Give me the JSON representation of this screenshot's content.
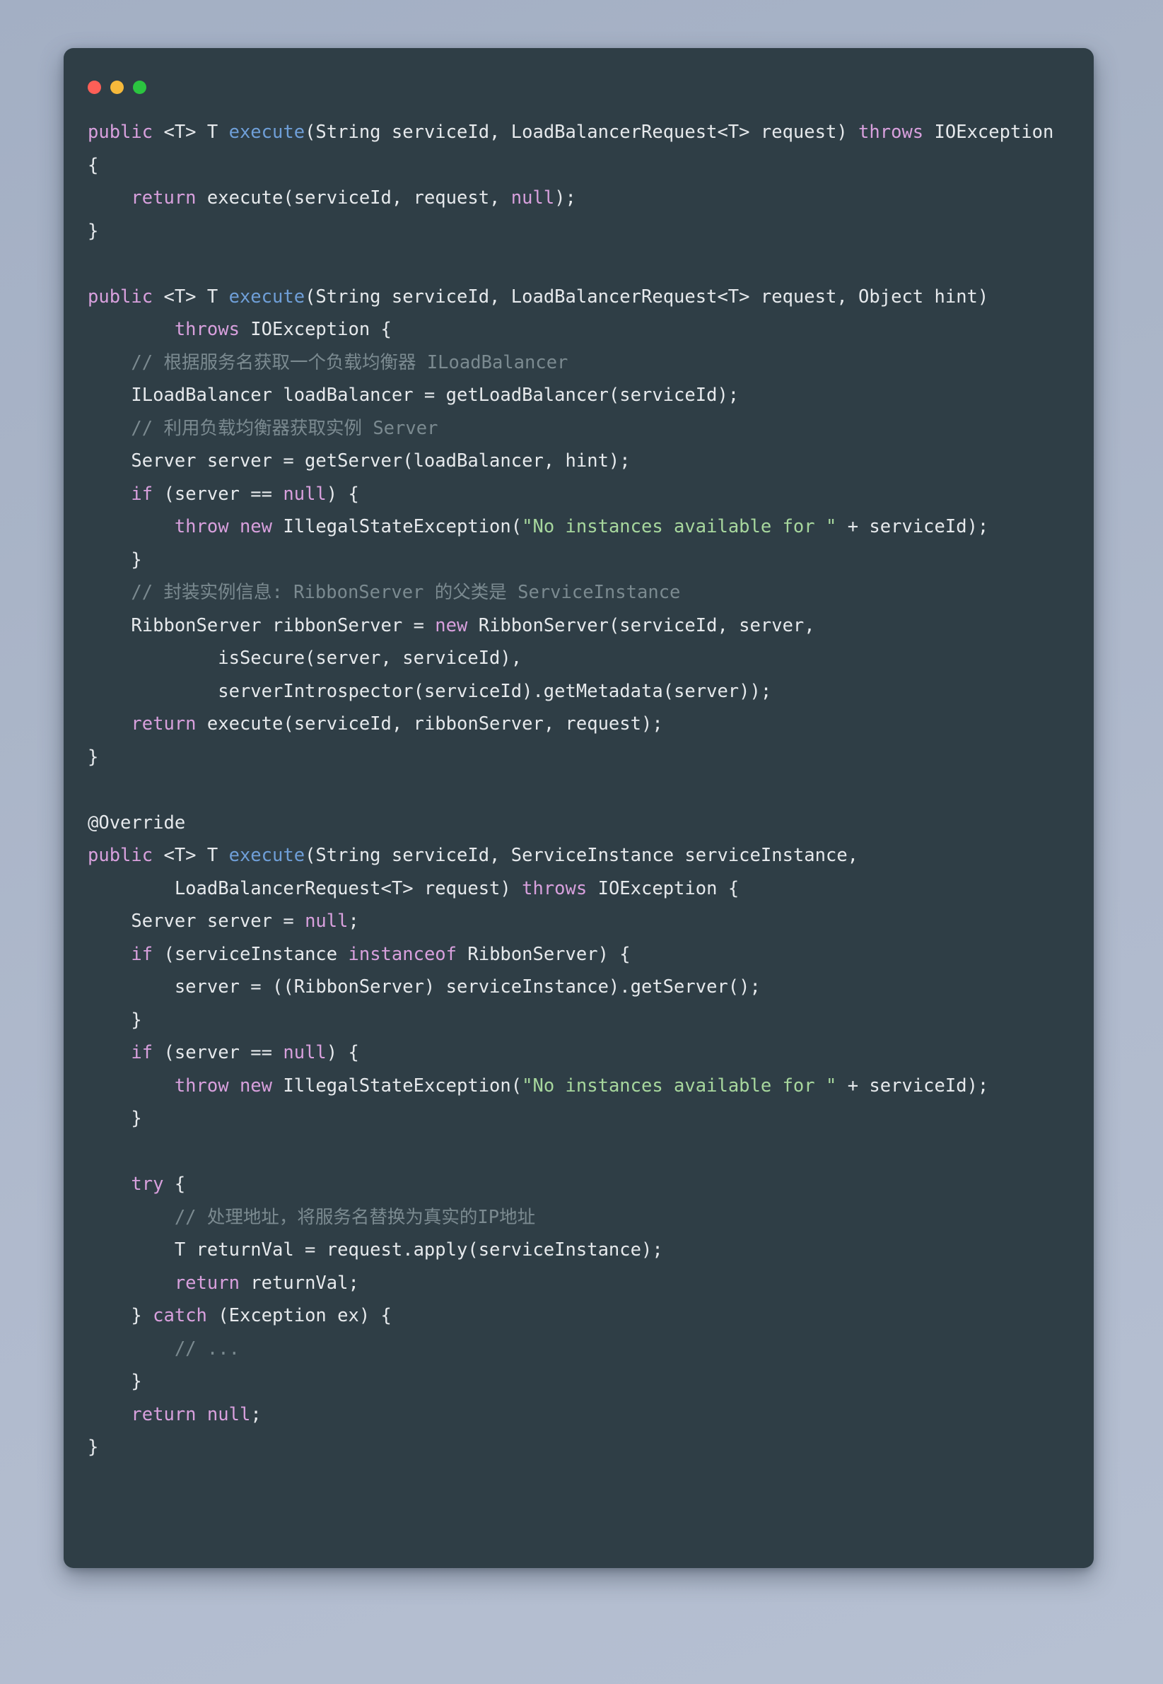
{
  "window": {
    "controls": [
      {
        "name": "close",
        "color": "#ff5f57"
      },
      {
        "name": "minimize",
        "color": "#f6b93b"
      },
      {
        "name": "maximize",
        "color": "#2bc540"
      }
    ]
  },
  "theme": {
    "page_background": "#a9b4c7",
    "card_background": "#2f3e46",
    "keyword": "#d8a0dd",
    "function": "#6f9fd8",
    "string": "#a7d79d",
    "comment": "#7b8a90",
    "text": "#e6e9ec"
  },
  "code": {
    "language": "java",
    "lines": [
      [
        {
          "t": "public",
          "c": "kw"
        },
        {
          "t": " <T> T ",
          "c": "txt"
        },
        {
          "t": "execute",
          "c": "fn"
        },
        {
          "t": "(String serviceId, LoadBalancerRequest<T> request) ",
          "c": "txt"
        },
        {
          "t": "throws",
          "c": "kw"
        },
        {
          "t": " IOException {",
          "c": "txt"
        }
      ],
      [
        {
          "t": "    ",
          "c": "txt"
        },
        {
          "t": "return",
          "c": "kw"
        },
        {
          "t": " execute(serviceId, request, ",
          "c": "txt"
        },
        {
          "t": "null",
          "c": "kw"
        },
        {
          "t": ");",
          "c": "txt"
        }
      ],
      [
        {
          "t": "}",
          "c": "txt"
        }
      ],
      [
        {
          "t": "",
          "c": "txt"
        }
      ],
      [
        {
          "t": "public",
          "c": "kw"
        },
        {
          "t": " <T> T ",
          "c": "txt"
        },
        {
          "t": "execute",
          "c": "fn"
        },
        {
          "t": "(String serviceId, LoadBalancerRequest<T> request, Object hint)",
          "c": "txt"
        }
      ],
      [
        {
          "t": "        ",
          "c": "txt"
        },
        {
          "t": "throws",
          "c": "kw"
        },
        {
          "t": " IOException {",
          "c": "txt"
        }
      ],
      [
        {
          "t": "    ",
          "c": "txt"
        },
        {
          "t": "// 根据服务名获取一个负载均衡器 ILoadBalancer",
          "c": "cmt"
        }
      ],
      [
        {
          "t": "    ILoadBalancer loadBalancer = getLoadBalancer(serviceId);",
          "c": "txt"
        }
      ],
      [
        {
          "t": "    ",
          "c": "txt"
        },
        {
          "t": "// 利用负载均衡器获取实例 Server",
          "c": "cmt"
        }
      ],
      [
        {
          "t": "    Server server = getServer(loadBalancer, hint);",
          "c": "txt"
        }
      ],
      [
        {
          "t": "    ",
          "c": "txt"
        },
        {
          "t": "if",
          "c": "kw"
        },
        {
          "t": " (server == ",
          "c": "txt"
        },
        {
          "t": "null",
          "c": "kw"
        },
        {
          "t": ") {",
          "c": "txt"
        }
      ],
      [
        {
          "t": "        ",
          "c": "txt"
        },
        {
          "t": "throw",
          "c": "kw"
        },
        {
          "t": " ",
          "c": "txt"
        },
        {
          "t": "new",
          "c": "kw"
        },
        {
          "t": " IllegalStateException(",
          "c": "txt"
        },
        {
          "t": "\"No instances available for \"",
          "c": "str"
        },
        {
          "t": " + serviceId);",
          "c": "txt"
        }
      ],
      [
        {
          "t": "    }",
          "c": "txt"
        }
      ],
      [
        {
          "t": "    ",
          "c": "txt"
        },
        {
          "t": "// 封装实例信息: RibbonServer 的父类是 ServiceInstance",
          "c": "cmt"
        }
      ],
      [
        {
          "t": "    RibbonServer ribbonServer = ",
          "c": "txt"
        },
        {
          "t": "new",
          "c": "kw"
        },
        {
          "t": " RibbonServer(serviceId, server,",
          "c": "txt"
        }
      ],
      [
        {
          "t": "            isSecure(server, serviceId),",
          "c": "txt"
        }
      ],
      [
        {
          "t": "            serverIntrospector(serviceId).getMetadata(server));",
          "c": "txt"
        }
      ],
      [
        {
          "t": "    ",
          "c": "txt"
        },
        {
          "t": "return",
          "c": "kw"
        },
        {
          "t": " execute(serviceId, ribbonServer, request);",
          "c": "txt"
        }
      ],
      [
        {
          "t": "}",
          "c": "txt"
        }
      ],
      [
        {
          "t": "",
          "c": "txt"
        }
      ],
      [
        {
          "t": "@Override",
          "c": "txt"
        }
      ],
      [
        {
          "t": "public",
          "c": "kw"
        },
        {
          "t": " <T> T ",
          "c": "txt"
        },
        {
          "t": "execute",
          "c": "fn"
        },
        {
          "t": "(String serviceId, ServiceInstance serviceInstance,",
          "c": "txt"
        }
      ],
      [
        {
          "t": "        LoadBalancerRequest<T> request) ",
          "c": "txt"
        },
        {
          "t": "throws",
          "c": "kw"
        },
        {
          "t": " IOException {",
          "c": "txt"
        }
      ],
      [
        {
          "t": "    Server server = ",
          "c": "txt"
        },
        {
          "t": "null",
          "c": "kw"
        },
        {
          "t": ";",
          "c": "txt"
        }
      ],
      [
        {
          "t": "    ",
          "c": "txt"
        },
        {
          "t": "if",
          "c": "kw"
        },
        {
          "t": " (serviceInstance ",
          "c": "txt"
        },
        {
          "t": "instanceof",
          "c": "kw"
        },
        {
          "t": " RibbonServer) {",
          "c": "txt"
        }
      ],
      [
        {
          "t": "        server = ((RibbonServer) serviceInstance).getServer();",
          "c": "txt"
        }
      ],
      [
        {
          "t": "    }",
          "c": "txt"
        }
      ],
      [
        {
          "t": "    ",
          "c": "txt"
        },
        {
          "t": "if",
          "c": "kw"
        },
        {
          "t": " (server == ",
          "c": "txt"
        },
        {
          "t": "null",
          "c": "kw"
        },
        {
          "t": ") {",
          "c": "txt"
        }
      ],
      [
        {
          "t": "        ",
          "c": "txt"
        },
        {
          "t": "throw",
          "c": "kw"
        },
        {
          "t": " ",
          "c": "txt"
        },
        {
          "t": "new",
          "c": "kw"
        },
        {
          "t": " IllegalStateException(",
          "c": "txt"
        },
        {
          "t": "\"No instances available for \"",
          "c": "str"
        },
        {
          "t": " + serviceId);",
          "c": "txt"
        }
      ],
      [
        {
          "t": "    }",
          "c": "txt"
        }
      ],
      [
        {
          "t": "",
          "c": "txt"
        }
      ],
      [
        {
          "t": "    ",
          "c": "txt"
        },
        {
          "t": "try",
          "c": "kw"
        },
        {
          "t": " {",
          "c": "txt"
        }
      ],
      [
        {
          "t": "        ",
          "c": "txt"
        },
        {
          "t": "// 处理地址，将服务名替换为真实的IP地址",
          "c": "cmt"
        }
      ],
      [
        {
          "t": "        T returnVal = request.apply(serviceInstance);",
          "c": "txt"
        }
      ],
      [
        {
          "t": "        ",
          "c": "txt"
        },
        {
          "t": "return",
          "c": "kw"
        },
        {
          "t": " returnVal;",
          "c": "txt"
        }
      ],
      [
        {
          "t": "    } ",
          "c": "txt"
        },
        {
          "t": "catch",
          "c": "kw"
        },
        {
          "t": " (Exception ex) {",
          "c": "txt"
        }
      ],
      [
        {
          "t": "        ",
          "c": "txt"
        },
        {
          "t": "// ...",
          "c": "cmt"
        }
      ],
      [
        {
          "t": "    }",
          "c": "txt"
        }
      ],
      [
        {
          "t": "    ",
          "c": "txt"
        },
        {
          "t": "return",
          "c": "kw"
        },
        {
          "t": " ",
          "c": "txt"
        },
        {
          "t": "null",
          "c": "kw"
        },
        {
          "t": ";",
          "c": "txt"
        }
      ],
      [
        {
          "t": "}",
          "c": "txt"
        }
      ]
    ]
  }
}
